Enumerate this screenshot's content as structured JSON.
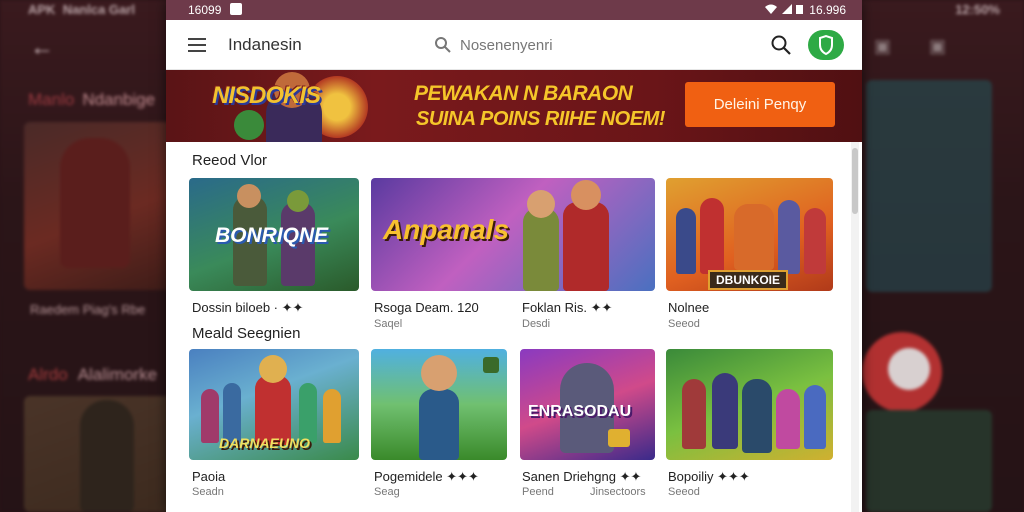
{
  "background": {
    "top_left": "APK",
    "top_left_2": "Nanlca Garl",
    "top_right": "12:50%",
    "section1": {
      "accent": "Manlo",
      "title": "Ndanbige"
    },
    "card1_caption": "Raedem Piag's Rbe",
    "section2": {
      "accent": "Alrdo",
      "title": "Alalimorke"
    }
  },
  "statusbar": {
    "time": "16099",
    "battery": "16.996"
  },
  "appbar": {
    "title": "Indanesin",
    "search_placeholder": "Nosenenyenri"
  },
  "banner": {
    "logo_text": "NISDOKIS",
    "line1": "PEWAKAN N BARAON",
    "line2": "SUINA POINS RIIHE NOEM!",
    "cta": "Deleini Penqy"
  },
  "sections": [
    {
      "title": "Reeod Vlor",
      "cards": [
        {
          "art": "BONRIQNE",
          "label": "Dossin biloeb · ✦✦",
          "sub": ""
        },
        {
          "art": "Anpanals",
          "label": "Rsoga Deam. 120",
          "sub": "Saqel"
        },
        {
          "art": "",
          "label": "Foklan Ris. ✦✦",
          "sub": "Desdi"
        },
        {
          "art": "DBUNKOIE",
          "label": "Nolnee",
          "sub": "Seeod"
        }
      ]
    },
    {
      "title": "Meald Seegnien",
      "cards": [
        {
          "art": "DARNAEUNO",
          "label": "Paoia",
          "sub": "Seadn"
        },
        {
          "art": "",
          "label": "Pogemidele ✦✦✦",
          "sub": "Seag"
        },
        {
          "art": "ENRASODAU",
          "label": "Sanen Driehgng ✦✦",
          "sub": "Peend",
          "sub2": "Jinsectoors"
        },
        {
          "art": "",
          "label": "Bopoiliy ✦✦✦",
          "sub": "Seeod"
        }
      ]
    }
  ],
  "colors": {
    "statusbar": "#6e3a4a",
    "banner": "#7a1a1c",
    "cta": "#f06012",
    "shield": "#2eaa45"
  }
}
